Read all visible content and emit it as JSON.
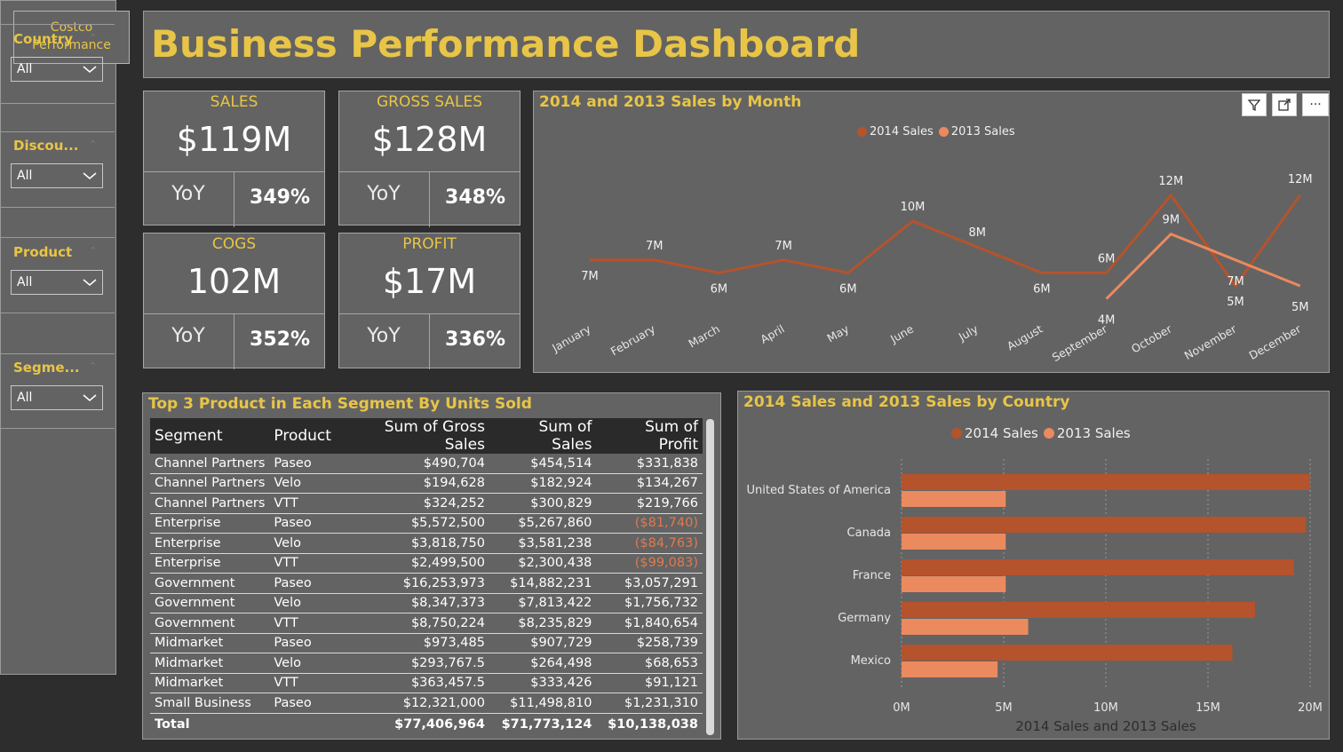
{
  "sidebar": {
    "logo": [
      "Costco",
      "Performance"
    ],
    "slicers": [
      {
        "title": "Country",
        "value": "All"
      },
      {
        "title": "Discou...",
        "value": "All"
      },
      {
        "title": "Product",
        "value": "All"
      },
      {
        "title": "Segme...",
        "value": "All"
      }
    ]
  },
  "header": {
    "title": "Business Performance Dashboard"
  },
  "kpis": [
    {
      "label": "SALES",
      "value": "$119M",
      "yoy": "YoY",
      "pct": "349%"
    },
    {
      "label": "GROSS SALES",
      "value": "$128M",
      "yoy": "YoY",
      "pct": "348%"
    },
    {
      "label": "COGS",
      "value": "102M",
      "yoy": "YoY",
      "pct": "352%"
    },
    {
      "label": "PROFIT",
      "value": "$17M",
      "yoy": "YoY",
      "pct": "336%"
    }
  ],
  "colors": {
    "s2014": "#b5532c",
    "s2013": "#ea8a5e",
    "accent": "#e8c547"
  },
  "line_chart": {
    "title": "2014 and 2013 Sales by Month",
    "legend": [
      "2014 Sales",
      "2013 Sales"
    ],
    "toolbar": [
      "filter-icon",
      "focus-mode-icon",
      "more-options-icon"
    ]
  },
  "table": {
    "title": "Top 3 Product in Each Segment By Units Sold",
    "headers": [
      "Segment",
      "Product",
      "Sum of Gross Sales",
      "Sum of Sales",
      "Sum of Profit"
    ],
    "rows": [
      [
        "Channel Partners",
        "Paseo",
        "$490,704",
        "$454,514",
        "$331,838"
      ],
      [
        "Channel Partners",
        "Velo",
        "$194,628",
        "$182,924",
        "$134,267"
      ],
      [
        "Channel Partners",
        "VTT",
        "$324,252",
        "$300,829",
        "$219,766"
      ],
      [
        "Enterprise",
        "Paseo",
        "$5,572,500",
        "$5,267,860",
        "($81,740)"
      ],
      [
        "Enterprise",
        "Velo",
        "$3,818,750",
        "$3,581,238",
        "($84,763)"
      ],
      [
        "Enterprise",
        "VTT",
        "$2,499,500",
        "$2,300,438",
        "($99,083)"
      ],
      [
        "Government",
        "Paseo",
        "$16,253,973",
        "$14,882,231",
        "$3,057,291"
      ],
      [
        "Government",
        "Velo",
        "$8,347,373",
        "$7,813,422",
        "$1,756,732"
      ],
      [
        "Government",
        "VTT",
        "$8,750,224",
        "$8,235,829",
        "$1,840,654"
      ],
      [
        "Midmarket",
        "Paseo",
        "$973,485",
        "$907,729",
        "$258,739"
      ],
      [
        "Midmarket",
        "Velo",
        "$293,767.5",
        "$264,498",
        "$68,653"
      ],
      [
        "Midmarket",
        "VTT",
        "$363,457.5",
        "$333,426",
        "$91,121"
      ],
      [
        "Small Business",
        "Paseo",
        "$12,321,000",
        "$11,498,810",
        "$1,231,310"
      ]
    ],
    "total": [
      "Total",
      "",
      "$77,406,964",
      "$71,773,124",
      "$10,138,038"
    ]
  },
  "bar_chart": {
    "title": "2014 Sales and 2013 Sales by Country",
    "legend": [
      "2014 Sales",
      "2013 Sales"
    ],
    "xlabel": "2014 Sales and 2013 Sales"
  },
  "chart_data": [
    {
      "type": "line",
      "title": "2014 and 2013 Sales by Month",
      "x": [
        "January",
        "February",
        "March",
        "April",
        "May",
        "June",
        "July",
        "August",
        "September",
        "October",
        "November",
        "December"
      ],
      "series": [
        {
          "name": "2014 Sales",
          "values": [
            7,
            7,
            6,
            7,
            6,
            10,
            8,
            6,
            6,
            12,
            5,
            12
          ],
          "labels": [
            "7M",
            "7M",
            "6M",
            "7M",
            "6M",
            "10M",
            "8M",
            "6M",
            "6M",
            "12M",
            "5M",
            "12M"
          ]
        },
        {
          "name": "2013 Sales",
          "values": [
            null,
            null,
            null,
            null,
            null,
            null,
            null,
            null,
            4,
            9,
            7,
            5
          ],
          "labels": [
            "",
            "",
            "",
            "",
            "",
            "",
            "",
            "",
            "4M",
            "9M",
            "7M",
            "5M"
          ]
        }
      ],
      "ylim": [
        0,
        13
      ]
    },
    {
      "type": "bar",
      "title": "2014 Sales and 2013 Sales by Country",
      "categories": [
        "United States of America",
        "Canada",
        "France",
        "Germany",
        "Mexico"
      ],
      "series": [
        {
          "name": "2014 Sales",
          "values": [
            20.0,
            19.8,
            19.2,
            17.3,
            16.2
          ]
        },
        {
          "name": "2013 Sales",
          "values": [
            5.1,
            5.1,
            5.1,
            6.2,
            4.7
          ]
        }
      ],
      "xticks": [
        "0M",
        "5M",
        "10M",
        "15M",
        "20M"
      ],
      "xlim": [
        0,
        20
      ],
      "xlabel": "2014 Sales and 2013 Sales"
    }
  ]
}
